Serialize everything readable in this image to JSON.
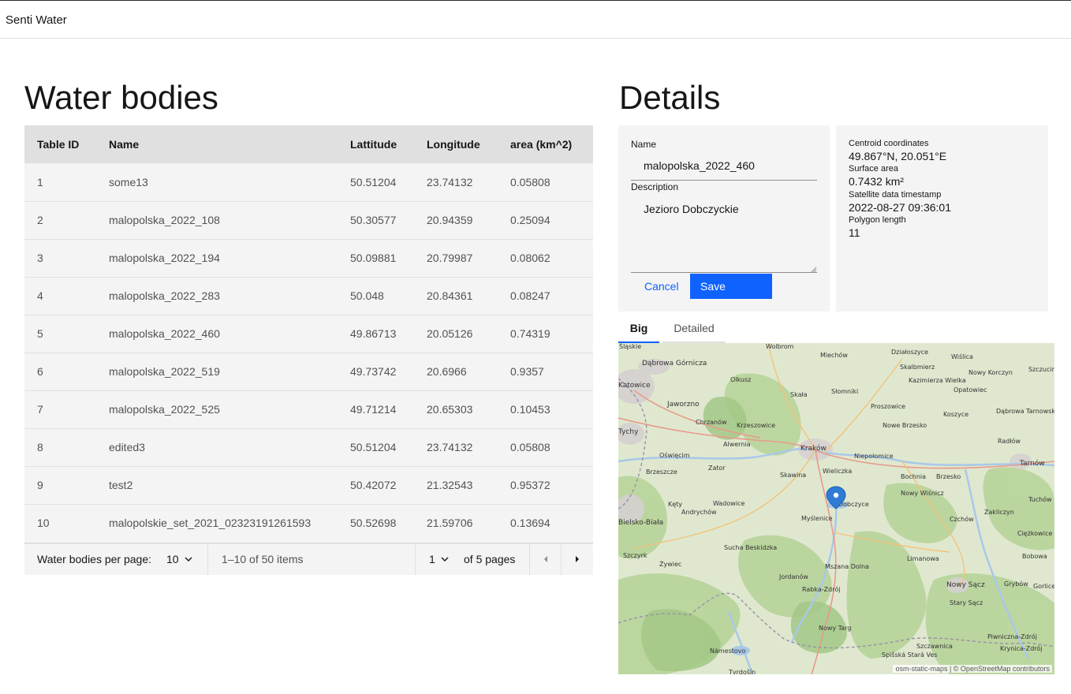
{
  "app": {
    "title": "Senti Water"
  },
  "list": {
    "title": "Water bodies",
    "columns": [
      "Table ID",
      "Name",
      "Lattitude",
      "Longitude",
      "area (km^2)"
    ],
    "rows": [
      [
        "1",
        "some13",
        "50.51204",
        "23.74132",
        "0.05808"
      ],
      [
        "2",
        "malopolska_2022_108",
        "50.30577",
        "20.94359",
        "0.25094"
      ],
      [
        "3",
        "malopolska_2022_194",
        "50.09881",
        "20.79987",
        "0.08062"
      ],
      [
        "4",
        "malopolska_2022_283",
        "50.048",
        "20.84361",
        "0.08247"
      ],
      [
        "5",
        "malopolska_2022_460",
        "49.86713",
        "20.05126",
        "0.74319"
      ],
      [
        "6",
        "malopolska_2022_519",
        "49.73742",
        "20.6966",
        "0.9357"
      ],
      [
        "7",
        "malopolska_2022_525",
        "49.71214",
        "20.65303",
        "0.10453"
      ],
      [
        "8",
        "edited3",
        "50.51204",
        "23.74132",
        "0.05808"
      ],
      [
        "9",
        "test2",
        "50.42072",
        "21.32543",
        "0.95372"
      ],
      [
        "10",
        "malopolskie_set_2021_02323191261593",
        "50.52698",
        "21.59706",
        "0.13694"
      ]
    ],
    "pagination": {
      "per_page_label": "Water bodies per page:",
      "per_page_value": "10",
      "range_text": "1–10 of 50 items",
      "page_value": "1",
      "of_pages_text": "of 5 pages"
    }
  },
  "details": {
    "title": "Details",
    "form": {
      "name_label": "Name",
      "name_value": "malopolska_2022_460",
      "description_label": "Description",
      "description_value": "Jezioro Dobczyckie",
      "cancel_label": "Cancel",
      "save_label": "Save"
    },
    "info": {
      "centroid_label": "Centroid coordinates",
      "centroid_value": "49.867°N, 20.051°E",
      "surface_label": "Surface area",
      "surface_value": "0.7432 km²",
      "timestamp_label": "Satellite data timestamp",
      "timestamp_value": "2022-08-27 09:36:01",
      "polygon_label": "Polygon length",
      "polygon_value": "11"
    },
    "tabs": [
      "Big",
      "Detailed"
    ],
    "map": {
      "attribution": "osm-static-maps | © OpenStreetMap contributors",
      "places": [
        {
          "name": "Śląskie"
        },
        {
          "name": "Wolbrom"
        },
        {
          "name": "Miechów"
        },
        {
          "name": "Działoszyce"
        },
        {
          "name": "Wiślica"
        },
        {
          "name": "Dąbrowa Górnicza"
        },
        {
          "name": "Skalbmierz"
        },
        {
          "name": "Nowy Korczyn"
        },
        {
          "name": "Szczucin"
        },
        {
          "name": "Katowice"
        },
        {
          "name": "Olkusz"
        },
        {
          "name": "Kazimierza Wielka"
        },
        {
          "name": "Opatowiec"
        },
        {
          "name": "Jaworzno"
        },
        {
          "name": "Skała"
        },
        {
          "name": "Słomniki"
        },
        {
          "name": "Proszowice"
        },
        {
          "name": "Koszyce"
        },
        {
          "name": "Dąbrowa Tarnowska"
        },
        {
          "name": "Tychy"
        },
        {
          "name": "Chrzanów"
        },
        {
          "name": "Krzeszowice"
        },
        {
          "name": "Nowe Brzesko"
        },
        {
          "name": "Radłów"
        },
        {
          "name": "Kraków"
        },
        {
          "name": "Niepołomice"
        },
        {
          "name": "Oświęcim"
        },
        {
          "name": "Alwernia"
        },
        {
          "name": "Wieliczka"
        },
        {
          "name": "Tarnów"
        },
        {
          "name": "Brzeszcze"
        },
        {
          "name": "Zator"
        },
        {
          "name": "Skawina"
        },
        {
          "name": "Bochnia"
        },
        {
          "name": "Brzesko"
        },
        {
          "name": "Kęty"
        },
        {
          "name": "Wadowice"
        },
        {
          "name": "Dobczyce"
        },
        {
          "name": "Nowy Wiśnicz"
        },
        {
          "name": "Tuchów"
        },
        {
          "name": "Bielsko-Biała"
        },
        {
          "name": "Andrychów"
        },
        {
          "name": "Myślenice"
        },
        {
          "name": "Zakliczyn"
        },
        {
          "name": "Czchów"
        },
        {
          "name": "Ciężkowice"
        },
        {
          "name": "Sucha Beskidzka"
        },
        {
          "name": "Szczyrk"
        },
        {
          "name": "Limanowa"
        },
        {
          "name": "Bobowa"
        },
        {
          "name": "Żywiec"
        },
        {
          "name": "Mszana Dolna"
        },
        {
          "name": "Jordanów"
        },
        {
          "name": "Gorlice"
        },
        {
          "name": "Rabka-Zdrój"
        },
        {
          "name": "Nowy Sącz"
        },
        {
          "name": "Grybów"
        },
        {
          "name": "Stary Sącz"
        },
        {
          "name": "Nowy Targ"
        },
        {
          "name": "Piwniczna-Zdrój"
        },
        {
          "name": "Szczawnica"
        },
        {
          "name": "Krynica-Zdrój"
        },
        {
          "name": "Námestovo"
        },
        {
          "name": "Spišská Stará Ves"
        },
        {
          "name": "Tvrdošín"
        },
        {
          "name": "Wieliczka"
        }
      ]
    }
  }
}
